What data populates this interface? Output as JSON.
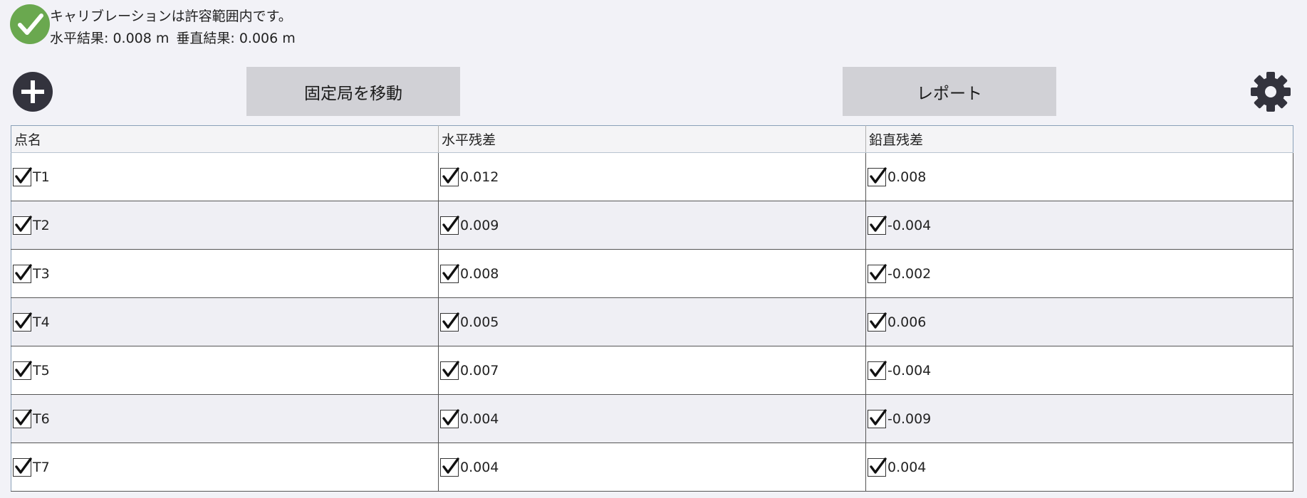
{
  "status": {
    "message": "キャリブレーションは許容範囲内です。",
    "horizontal_result": "水平結果: 0.008 m",
    "vertical_result": "垂直結果: 0.006 m",
    "icon": "checkmark-circle-icon",
    "color": "#6aa84f"
  },
  "toolbar": {
    "add_icon": "plus-circle-icon",
    "move_base_label": "固定局を移動",
    "report_label": "レポート",
    "settings_icon": "gear-icon"
  },
  "table": {
    "columns": [
      "点名",
      "水平残差",
      "鉛直残差"
    ],
    "rows": [
      {
        "name": "T1",
        "horizontal": "0.012",
        "vertical": "0.008"
      },
      {
        "name": "T2",
        "horizontal": "0.009",
        "vertical": "-0.004"
      },
      {
        "name": "T3",
        "horizontal": "0.008",
        "vertical": "-0.002"
      },
      {
        "name": "T4",
        "horizontal": "0.005",
        "vertical": "0.006"
      },
      {
        "name": "T5",
        "horizontal": "0.007",
        "vertical": "-0.004"
      },
      {
        "name": "T6",
        "horizontal": "0.004",
        "vertical": "-0.009"
      },
      {
        "name": "T7",
        "horizontal": "0.004",
        "vertical": "0.004"
      }
    ]
  }
}
